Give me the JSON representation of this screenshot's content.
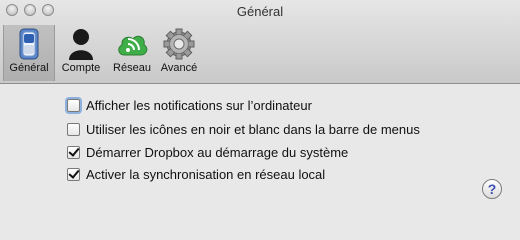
{
  "window": {
    "title": "Général"
  },
  "toolbar": {
    "items": [
      {
        "label": "Général",
        "icon": "general-switch-icon",
        "selected": true
      },
      {
        "label": "Compte",
        "icon": "account-person-icon",
        "selected": false
      },
      {
        "label": "Réseau",
        "icon": "network-icon",
        "selected": false
      },
      {
        "label": "Avancé",
        "icon": "advanced-gear-icon",
        "selected": false
      }
    ]
  },
  "options": [
    {
      "label": "Afficher les notifications sur l’ordinateur",
      "checked": false
    },
    {
      "label": "Utiliser les icônes en noir et blanc dans la barre de menus",
      "checked": false
    },
    {
      "label": "Démarrer Dropbox au démarrage du système",
      "checked": true
    },
    {
      "label": "Activer la synchronisation en réseau local",
      "checked": true
    }
  ],
  "help": {
    "label": "?"
  }
}
